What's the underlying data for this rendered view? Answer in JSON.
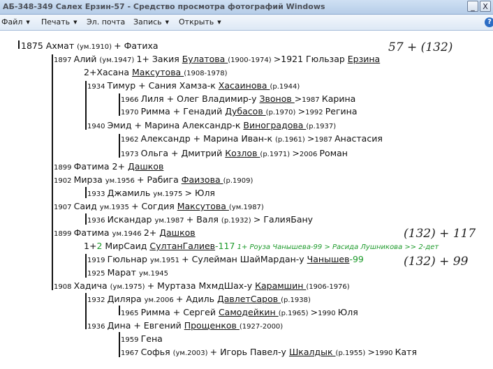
{
  "window": {
    "title": "АБ-348-349 Салех Ерзин-57 - Средство просмотра фотографий Windows",
    "min_label": "_",
    "close_label": "X"
  },
  "menu": {
    "file": "Файл",
    "print": "Печать",
    "email": "Эл. почта",
    "burn": "Запись",
    "open": "Открыть",
    "help_glyph": "?"
  },
  "annotations": {
    "a1": "57 + (132)",
    "a2": "(132) + 117",
    "a3": "(132) + 99"
  },
  "lines": [
    {
      "segs": [
        [
          "n",
          "1875 "
        ],
        [
          "b",
          "Ахмат "
        ],
        [
          "s",
          "(ум.1910) "
        ],
        [
          "i",
          "+ Фатиха"
        ]
      ]
    },
    {
      "segs": [
        [
          "s",
          "1897 "
        ],
        [
          "b",
          "Алий "
        ],
        [
          "s",
          "(ум.1947) "
        ],
        [
          "n",
          "1+ "
        ],
        [
          "i",
          "Закия "
        ],
        [
          "iu",
          "Булатова "
        ],
        [
          "si",
          "(1900-1974) "
        ],
        [
          "i",
          ">1921 Гюльзар "
        ],
        [
          "iu",
          "Ерзина"
        ]
      ]
    },
    {
      "segs": [
        [
          "n",
          "2+Хасана "
        ],
        [
          "iu",
          "Максутова "
        ],
        [
          "s",
          "(1908-1978)"
        ]
      ]
    },
    {
      "segs": [
        [
          "s",
          "1934 "
        ],
        [
          "b",
          "Тимур "
        ],
        [
          "i",
          "+ Сания Хамза-к "
        ],
        [
          "iu",
          "Хасаинова "
        ],
        [
          "si",
          "(р.1944)"
        ]
      ]
    },
    {
      "segs": [
        [
          "si",
          "1966 "
        ],
        [
          "i",
          "Лиля "
        ],
        [
          "n",
          "+ Олег Владимир-у "
        ],
        [
          "u",
          "Звонов "
        ],
        [
          "i",
          ">"
        ],
        [
          "si",
          "1987 "
        ],
        [
          "i",
          "Карина"
        ]
      ]
    },
    {
      "segs": [
        [
          "si",
          "1970 "
        ],
        [
          "i",
          "Римма "
        ],
        [
          "n",
          "+ Генадий "
        ],
        [
          "u",
          "Дубасов "
        ],
        [
          "s",
          "(р.1970) "
        ],
        [
          "i",
          ">"
        ],
        [
          "si",
          "1992 "
        ],
        [
          "i",
          "Регина"
        ]
      ]
    },
    {
      "segs": [
        [
          "s",
          "1940 "
        ],
        [
          "b",
          "Эмид "
        ],
        [
          "i",
          "+ Марина Александр-к "
        ],
        [
          "iu",
          "Виноградова "
        ],
        [
          "si",
          "(р.1937)"
        ]
      ]
    },
    {
      "segs": [
        [
          "s",
          "1962 "
        ],
        [
          "n",
          "Александр + "
        ],
        [
          "i",
          "Марина Иван-к "
        ],
        [
          "si",
          "(р.1961) "
        ],
        [
          "n",
          ">"
        ],
        [
          "s",
          "1987 "
        ],
        [
          "n",
          "Анастасия"
        ]
      ]
    },
    {
      "segs": [
        [
          "si",
          "1973 "
        ],
        [
          "i",
          "Ольга "
        ],
        [
          "n",
          "+ Дмитрий "
        ],
        [
          "u",
          "Козлов "
        ],
        [
          "s",
          "(р.1971) "
        ],
        [
          "n",
          ">"
        ],
        [
          "s",
          "2006 "
        ],
        [
          "n",
          "Роман"
        ]
      ]
    },
    {
      "segs": [
        [
          "si",
          "1899 "
        ],
        [
          "i",
          "Фатима "
        ],
        [
          "n",
          "2+ "
        ],
        [
          "u",
          "Дашков"
        ]
      ]
    },
    {
      "segs": [
        [
          "s",
          "1902 "
        ],
        [
          "b",
          "Мирза "
        ],
        [
          "s",
          "ум.1956 "
        ],
        [
          "i",
          "+ Рабига "
        ],
        [
          "iu",
          "Фаизова "
        ],
        [
          "si",
          "(р.1909)"
        ]
      ]
    },
    {
      "segs": [
        [
          "s",
          "1933 "
        ],
        [
          "b",
          "Джамиль "
        ],
        [
          "s",
          "ум.1975 "
        ],
        [
          "i",
          "> Юля"
        ]
      ]
    },
    {
      "segs": [
        [
          "s",
          "1907 "
        ],
        [
          "b",
          "Саид "
        ],
        [
          "s",
          "ум.1935 "
        ],
        [
          "i",
          "+ Согдия "
        ],
        [
          "iu",
          "Максутова "
        ],
        [
          "si",
          "(ум.1987)"
        ]
      ]
    },
    {
      "segs": [
        [
          "s",
          "1936 "
        ],
        [
          "b",
          "Искандар "
        ],
        [
          "s",
          "ум.1987 "
        ],
        [
          "i",
          "+ Валя "
        ],
        [
          "si",
          "(р.1932) "
        ],
        [
          "i",
          "> ГалияБану"
        ]
      ]
    },
    {
      "segs": [
        [
          "si",
          "1899 "
        ],
        [
          "i",
          "Фатима "
        ],
        [
          "si",
          "ум.1946 "
        ],
        [
          "n",
          "2+ "
        ],
        [
          "u",
          "Дашков"
        ]
      ]
    },
    {
      "segs": [
        [
          "n",
          "1+"
        ],
        [
          "g",
          "2 "
        ],
        [
          "n",
          "МирСаид "
        ],
        [
          "u",
          "СултанГалиев"
        ],
        [
          "g",
          "-117"
        ],
        [
          "gi",
          "    1+ Роуза Чанышева-99 > Расида Лушникова >> 2-дет"
        ]
      ]
    },
    {
      "segs": [
        [
          "si",
          "1919 "
        ],
        [
          "n",
          "Гюльнар "
        ],
        [
          "s",
          "ум.1951 "
        ],
        [
          "n",
          "+ Сулейман ШайМардан-у "
        ],
        [
          "u",
          "Чанышев"
        ],
        [
          "g",
          "-99"
        ]
      ]
    },
    {
      "segs": [
        [
          "s",
          "1925 "
        ],
        [
          "n",
          "Марат "
        ],
        [
          "s",
          "ум.1945"
        ]
      ]
    },
    {
      "segs": [
        [
          "si",
          "1908 "
        ],
        [
          "i",
          "Хадича "
        ],
        [
          "si",
          "(ум.1975) "
        ],
        [
          "n",
          "+ Муртаза МхмдШах-у "
        ],
        [
          "u",
          "Карамшин "
        ],
        [
          "s",
          "(1906-1976)"
        ]
      ]
    },
    {
      "segs": [
        [
          "si",
          "1932 "
        ],
        [
          "i",
          "Диляра "
        ],
        [
          "si",
          "ум.2006 "
        ],
        [
          "n",
          "+ Адиль "
        ],
        [
          "u",
          "ДавлетСаров "
        ],
        [
          "s",
          "(р.1938)"
        ]
      ]
    },
    {
      "segs": [
        [
          "si",
          "1965 "
        ],
        [
          "i",
          "Римма "
        ],
        [
          "n",
          "+ Сергей "
        ],
        [
          "u",
          "Самодейкин "
        ],
        [
          "s",
          "(р.1965) "
        ],
        [
          "i",
          ">"
        ],
        [
          "si",
          "1990 "
        ],
        [
          "i",
          "Юля"
        ]
      ]
    },
    {
      "segs": [
        [
          "s",
          "1936 "
        ],
        [
          "i",
          "Дина "
        ],
        [
          "n",
          "+ Евгений "
        ],
        [
          "u",
          "Прощенков "
        ],
        [
          "s",
          "(1927-2000)"
        ]
      ]
    },
    {
      "segs": [
        [
          "s",
          "1959 "
        ],
        [
          "n",
          "Гена"
        ]
      ]
    },
    {
      "segs": [
        [
          "si",
          "1967 "
        ],
        [
          "i",
          "Софья "
        ],
        [
          "si",
          "(ум.2003) "
        ],
        [
          "n",
          "+ Игорь Павел-у "
        ],
        [
          "u",
          "Шкалдык "
        ],
        [
          "s",
          "(р.1955) "
        ],
        [
          "i",
          ">"
        ],
        [
          "si",
          "1990 "
        ],
        [
          "i",
          "Катя"
        ]
      ]
    }
  ]
}
